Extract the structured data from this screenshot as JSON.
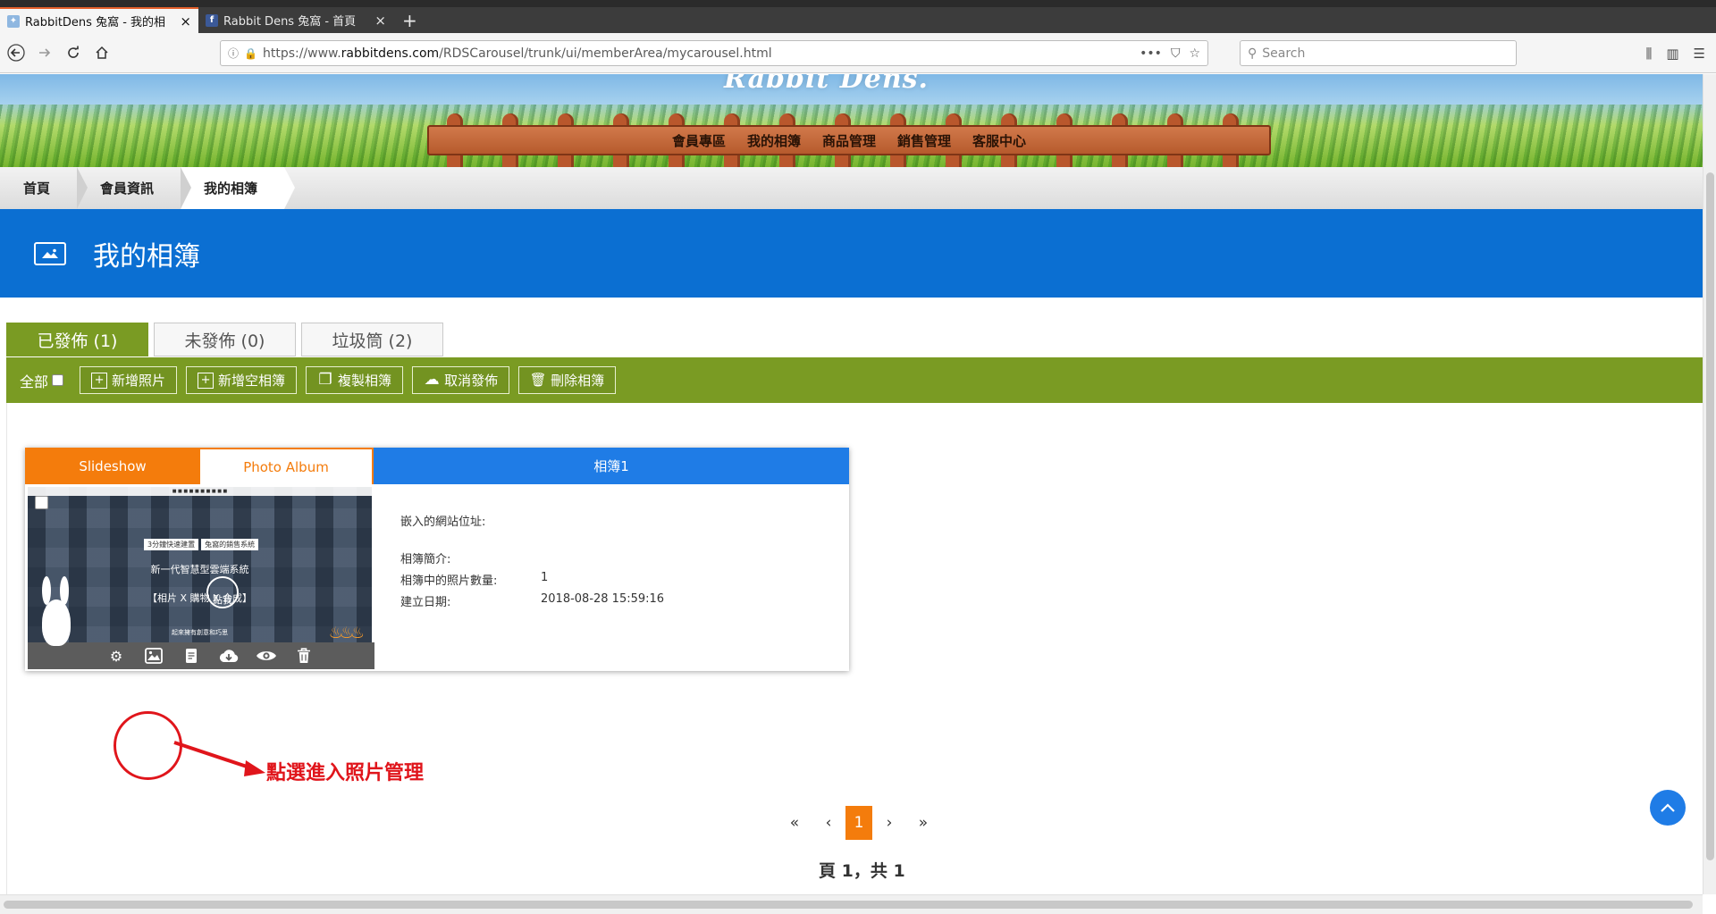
{
  "browser": {
    "tabs": [
      {
        "title": "RabbitDens 兔窩 - 我的相",
        "active": true,
        "close": "×",
        "favicon": "rabbitdens-icon"
      },
      {
        "title": "Rabbit Dens 兔窩 - 首頁",
        "active": false,
        "close": "×",
        "favicon": "facebook-icon"
      }
    ],
    "new_tab": "+",
    "url_prefix": "https://www.",
    "url_host": "rabbitdens.com",
    "url_path": "/RDSCarousel/trunk/ui/memberArea/mycarousel.html",
    "url_more": "•••",
    "search_placeholder": "Search"
  },
  "site": {
    "logo_text": "Rabbit Dens.",
    "menu": [
      "會員專區",
      "我的相簿",
      "商品管理",
      "銷售管理",
      "客服中心"
    ]
  },
  "breadcrumb": [
    "首頁",
    "會員資訊",
    "我的相簿"
  ],
  "page_title": "我的相簿",
  "tabs": [
    {
      "label": "已發佈 (1)",
      "active": true
    },
    {
      "label": "未發佈 (0)",
      "active": false
    },
    {
      "label": "垃圾筒 (2)",
      "active": false
    }
  ],
  "toolbar": {
    "all_label": "全部",
    "buttons": [
      {
        "label": "新增照片",
        "icon": "+"
      },
      {
        "label": "新增空相簿",
        "icon": "+"
      },
      {
        "label": "複製相簿",
        "icon": "❐"
      },
      {
        "label": "取消發佈",
        "icon": "☁"
      },
      {
        "label": "刪除相簿",
        "icon": "🗑"
      }
    ]
  },
  "album": {
    "tab_slideshow": "Slideshow",
    "tab_photo_album": "Photo Album",
    "name": "相簿1",
    "thumbnail": {
      "badge_1": "3分鐘快速建置",
      "badge_2": "兔窩的銷售系統",
      "line_1": "新一代智慧型雲端系統",
      "line_2": "【相片 X 購物 X 合成】",
      "click_text": "點我",
      "line_3": "起來擁有創意和巧思"
    },
    "fields": {
      "embed_label": "嵌入的網站位址:",
      "embed_value": "",
      "intro_label": "相簿簡介:",
      "intro_value": "",
      "count_label": "相簿中的照片數量:",
      "count_value": "1",
      "date_label": "建立日期:",
      "date_value": "2018-08-28 15:59:16"
    }
  },
  "annotation": {
    "text": "點選進入照片管理",
    "color": "#e0151b"
  },
  "pagination": {
    "first": "«",
    "prev": "‹",
    "current": "1",
    "next": "›",
    "last": "»",
    "info": "頁 1，共 1"
  },
  "colors": {
    "header_blue": "#0b6fd2",
    "toolbar_green": "#7a9b23",
    "accent_orange": "#f47c0c",
    "album_blue": "#1f7ce6"
  }
}
